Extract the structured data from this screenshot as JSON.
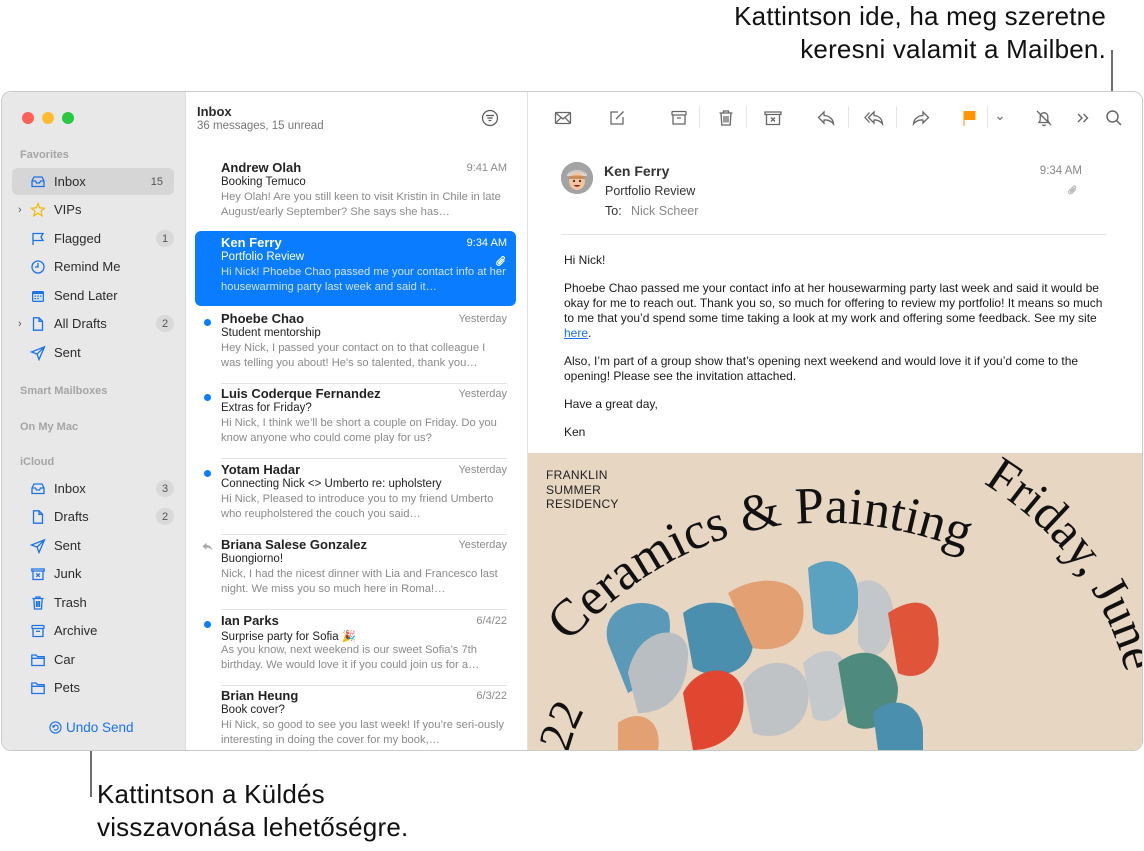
{
  "callouts": {
    "search": [
      "Kattintson ide, ha meg szeretne",
      "keresni valamit a Mailben."
    ],
    "undo_send": [
      "Kattintson a Küldés",
      "visszavonása lehetőségre."
    ]
  },
  "sidebar": {
    "sections": {
      "favorites": "Favorites",
      "smart_mailboxes": "Smart Mailboxes",
      "on_my_mac": "On My Mac",
      "icloud": "iCloud"
    },
    "favorites": [
      {
        "label": "Inbox",
        "icon": "inbox-icon",
        "badge": "15",
        "selected": true
      },
      {
        "label": "VIPs",
        "icon": "star-icon",
        "expandable": true
      },
      {
        "label": "Flagged",
        "icon": "flag-icon",
        "badge": "1"
      },
      {
        "label": "Remind Me",
        "icon": "clock-icon"
      },
      {
        "label": "Send Later",
        "icon": "calendar-icon"
      },
      {
        "label": "All Drafts",
        "icon": "document-icon",
        "badge": "2",
        "expandable": true
      },
      {
        "label": "Sent",
        "icon": "paperplane-icon"
      }
    ],
    "icloud": [
      {
        "label": "Inbox",
        "icon": "inbox-icon",
        "badge": "3"
      },
      {
        "label": "Drafts",
        "icon": "document-icon",
        "badge": "2"
      },
      {
        "label": "Sent",
        "icon": "paperplane-icon"
      },
      {
        "label": "Junk",
        "icon": "junk-icon"
      },
      {
        "label": "Trash",
        "icon": "trash-icon"
      },
      {
        "label": "Archive",
        "icon": "archive-icon"
      },
      {
        "label": "Car",
        "icon": "folder-icon"
      },
      {
        "label": "Pets",
        "icon": "folder-icon"
      }
    ],
    "undo_send": "Undo Send"
  },
  "message_list": {
    "title": "Inbox",
    "subtitle": "36 messages, 15 unread",
    "messages": [
      {
        "from": "Andrew Olah",
        "time": "9:41 AM",
        "subject": "Booking Temuco",
        "preview": "Hey Olah! Are you still keen to visit Kristin in Chile in late August/early September? She says she has…",
        "unread": false
      },
      {
        "from": "Ken Ferry",
        "time": "9:34 AM",
        "subject": "Portfolio Review",
        "preview": "Hi Nick! Phoebe Chao passed me your contact info at her housewarming party last week and said it…",
        "unread": false,
        "selected": true,
        "attachment": true
      },
      {
        "from": "Phoebe Chao",
        "time": "Yesterday",
        "subject": "Student mentorship",
        "preview": "Hey Nick, I passed your contact on to that colleague I was telling you about! He's so talented, thank you…",
        "unread": true
      },
      {
        "from": "Luis Coderque Fernandez",
        "time": "Yesterday",
        "subject": "Extras for Friday?",
        "preview": "Hi Nick, I think we’ll be short a couple on Friday. Do you know anyone who could come play for us?",
        "unread": true
      },
      {
        "from": "Yotam Hadar",
        "time": "Yesterday",
        "subject": "Connecting Nick <> Umberto re: upholstery",
        "preview": "Hi Nick, Pleased to introduce you to my friend Umberto who reupholstered the couch you said…",
        "unread": true
      },
      {
        "from": "Briana Salese Gonzalez",
        "time": "Yesterday",
        "subject": "Buongiorno!",
        "preview": "Nick, I had the nicest dinner with Lia and Francesco last night. We miss you so much here in Roma!…",
        "unread": false,
        "replied": true
      },
      {
        "from": "Ian Parks",
        "time": "6/4/22",
        "subject": "Surprise party for Sofia 🎉",
        "preview": "As you know, next weekend is our sweet Sofia’s 7th birthday. We would love it if you could join us for a…",
        "unread": true
      },
      {
        "from": "Brian Heung",
        "time": "6/3/22",
        "subject": "Book cover?",
        "preview": "Hi Nick, so good to see you last week! If you’re seri-ously interesting in doing the cover for my book,…",
        "unread": false
      }
    ]
  },
  "toolbar": {
    "buttons": [
      "get-mail",
      "compose",
      "archive",
      "delete",
      "junk",
      "reply",
      "reply-all",
      "forward",
      "flag",
      "flag-menu",
      "mute",
      "more",
      "search"
    ],
    "flag_color": "#ff9500"
  },
  "reader": {
    "from": "Ken Ferry",
    "subject": "Portfolio Review",
    "to_label": "To:",
    "to": "Nick Scheer",
    "time": "9:34 AM",
    "body": {
      "greeting": "Hi Nick!",
      "p1": "Phoebe Chao passed me your contact info at her housewarming party last week and said it would be okay for me to reach out. Thank you so, so much for offering to review my portfolio! It means so much to me that you’d spend some time taking a look at my work and offering some feedback. See my site ",
      "link": "here",
      "p1_end": ".",
      "p2": "Also, I’m part of a group show that’s opening next weekend and would love it if you’d come to the opening! Please see the invitation attached.",
      "closing": "Have a great day,",
      "signature": "Ken"
    },
    "attachment_poster": {
      "org": [
        "FRANKLIN",
        "SUMMER",
        "RESIDENCY"
      ],
      "title": "Ceramics & Painting",
      "date_text": "Friday, June",
      "year_fragment": "22"
    }
  },
  "colors": {
    "accent": "#0a7cff",
    "sidebar_icon": "#1a73e8",
    "vip_star": "#f5b800",
    "poster_bg": "#e7d6c2"
  }
}
